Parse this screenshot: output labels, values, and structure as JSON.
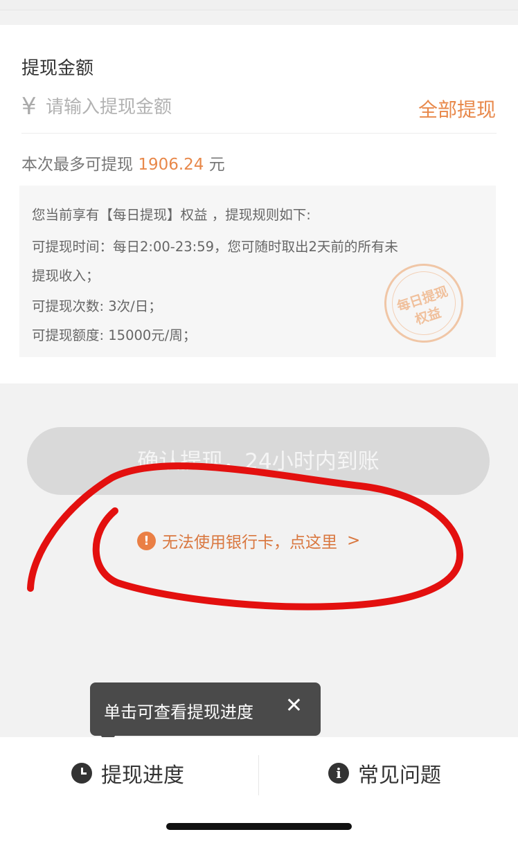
{
  "amount": {
    "title": "提现金额",
    "currency_symbol": "¥",
    "placeholder": "请输入提现金额",
    "withdraw_all_label": "全部提现"
  },
  "max_withdraw": {
    "prefix": "本次最多可提现",
    "amount": "1906.24",
    "unit": "元"
  },
  "rules": {
    "lines": [
      "您当前享有【每日提现】权益 ，提现规则如下:",
      "可提现时间：每日2:00-23:59，您可随时取出2天前的所有未",
      "提现收入；",
      "可提现次数: 3次/日；",
      "可提现额度: 15000元/周；"
    ],
    "stamp_line1": "每日提现",
    "stamp_line2": "权益"
  },
  "confirm_button_label": "确认提现，24小时内到账",
  "bank_card_help": {
    "label": "无法使用银行卡，点这里",
    "icon": "exclamation-circle-icon"
  },
  "tooltip": {
    "text": "单击可查看提现进度",
    "close_glyph": "✕"
  },
  "tabs": [
    {
      "label": "提现进度",
      "icon": "clock-icon"
    },
    {
      "label": "常见问题",
      "icon": "info-icon"
    }
  ],
  "colors": {
    "accent": "#e8884a",
    "annotation_red": "#e3100f",
    "button_disabled": "#d9d9d9",
    "tooltip_bg": "#4a4a4a"
  }
}
